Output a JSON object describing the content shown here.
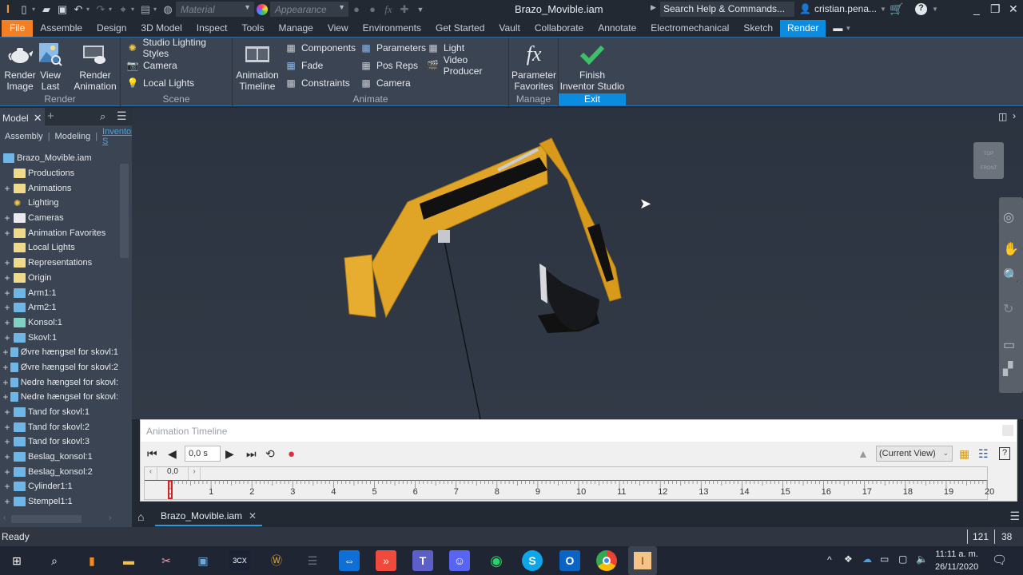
{
  "app": {
    "document_title": "Brazo_Movible.iam",
    "search_placeholder": "Search Help & Commands...",
    "user": "cristian.pena...",
    "material_combo": "Material",
    "appearance_combo": "Appearance"
  },
  "tabs": [
    "File",
    "Assemble",
    "Design",
    "3D Model",
    "Inspect",
    "Tools",
    "Manage",
    "View",
    "Environments",
    "Get Started",
    "Vault",
    "Collaborate",
    "Annotate",
    "Electromechanical",
    "Sketch",
    "Render"
  ],
  "active_tab": "Render",
  "ribbon": {
    "render": {
      "label": "Render",
      "render_image": "Render\nImage",
      "view_last": "View\nLast",
      "render_animation": "Render\nAnimation"
    },
    "scene": {
      "label": "Scene",
      "items": [
        "Studio Lighting Styles",
        "Camera",
        "Local Lights"
      ]
    },
    "animate": {
      "label": "Animate",
      "timeline": "Animation\nTimeline",
      "col1": [
        "Components",
        "Fade",
        "Constraints"
      ],
      "col2": [
        "Parameters",
        "Pos Reps",
        "Camera"
      ],
      "col3": [
        "Light",
        "Video Producer"
      ]
    },
    "manage": {
      "label": "Manage",
      "parameter_favorites": "Parameter\nFavorites"
    },
    "exit": {
      "label": "Exit",
      "finish": "Finish\nInventor Studio"
    }
  },
  "browser": {
    "tab": "Model",
    "subtabs": [
      "Assembly",
      "Modeling",
      "Inventor S"
    ],
    "root": "Brazo_Movible.iam",
    "nodes": [
      {
        "label": "Productions",
        "type": "folder",
        "expand": false
      },
      {
        "label": "Animations",
        "type": "folder",
        "expand": true
      },
      {
        "label": "Lighting",
        "type": "light",
        "expand": false
      },
      {
        "label": "Cameras",
        "type": "camera",
        "expand": true
      },
      {
        "label": "Animation Favorites",
        "type": "folder",
        "expand": true
      },
      {
        "label": "Local Lights",
        "type": "folder",
        "expand": false
      },
      {
        "label": "Representations",
        "type": "folder",
        "expand": true
      },
      {
        "label": "Origin",
        "type": "folder",
        "expand": true
      },
      {
        "label": "Arm1:1",
        "type": "part",
        "expand": true
      },
      {
        "label": "Arm2:1",
        "type": "part",
        "expand": true
      },
      {
        "label": "Konsol:1",
        "type": "konsol",
        "expand": true
      },
      {
        "label": "Skovl:1",
        "type": "part",
        "expand": true
      },
      {
        "label": "Øvre hængsel for skovl:1",
        "type": "part",
        "expand": true
      },
      {
        "label": "Øvre hængsel for skovl:2",
        "type": "part",
        "expand": true
      },
      {
        "label": "Nedre hængsel for skovl:",
        "type": "part",
        "expand": true
      },
      {
        "label": "Nedre hængsel for skovl:",
        "type": "part",
        "expand": true
      },
      {
        "label": "Tand for skovl:1",
        "type": "part",
        "expand": true
      },
      {
        "label": "Tand for skovl:2",
        "type": "part",
        "expand": true
      },
      {
        "label": "Tand for skovl:3",
        "type": "part",
        "expand": true
      },
      {
        "label": "Beslag_konsol:1",
        "type": "part",
        "expand": true
      },
      {
        "label": "Beslag_konsol:2",
        "type": "part",
        "expand": true
      },
      {
        "label": "Cylinder1:1",
        "type": "part",
        "expand": true
      },
      {
        "label": "Stempel1:1",
        "type": "part",
        "expand": true
      }
    ]
  },
  "viewcube": {
    "top": "TOP",
    "front": "FRONT"
  },
  "timeline": {
    "title": "Animation Timeline",
    "time": "0,0 s",
    "ruler_value": "0,0",
    "camera_view": "(Current View)",
    "ticks": [
      "0",
      "1",
      "2",
      "3",
      "4",
      "5",
      "6",
      "7",
      "8",
      "9",
      "10",
      "11",
      "12",
      "13",
      "14",
      "15",
      "16",
      "17",
      "18",
      "19",
      "20"
    ]
  },
  "doc_tab": "Brazo_Movible.iam",
  "status": {
    "text": "Ready",
    "count1": "121",
    "count2": "38"
  },
  "taskbar": {
    "time": "11:11 a. m.",
    "date": "26/11/2020"
  },
  "colors": {
    "accent": "#0a8de0",
    "file_tab": "#f47f23",
    "excavator": "#e0a526"
  }
}
